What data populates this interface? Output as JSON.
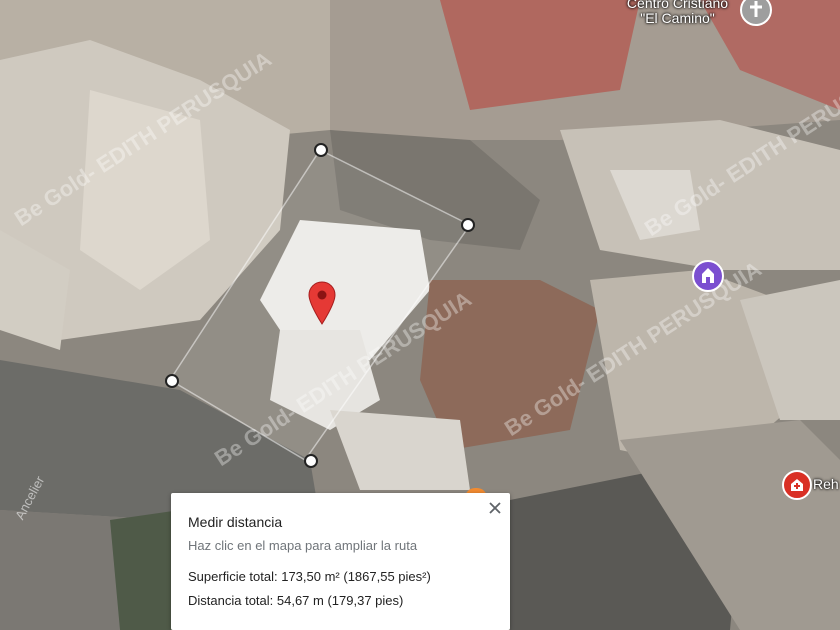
{
  "map": {
    "view": "satellite",
    "poi_label_line1": "Centro Cristiano",
    "poi_label_line2": "\"El Camino\"",
    "partial_label": "Reh",
    "street_label": "Ancelier",
    "watermark": "Be Gold- EDITH PERUSQUIA",
    "colors": {
      "pin": "#e53935",
      "poi_purple": "#7b4fd0",
      "poi_red": "#d93025"
    }
  },
  "measure": {
    "title": "Medir distancia",
    "hint": "Haz clic en el mapa para ampliar la ruta",
    "area": "Superficie total: 173,50 m² (1867,55 pies²)",
    "distance": "Distancia total: 54,67 m (179,37 pies)",
    "close_icon": "close-icon"
  }
}
